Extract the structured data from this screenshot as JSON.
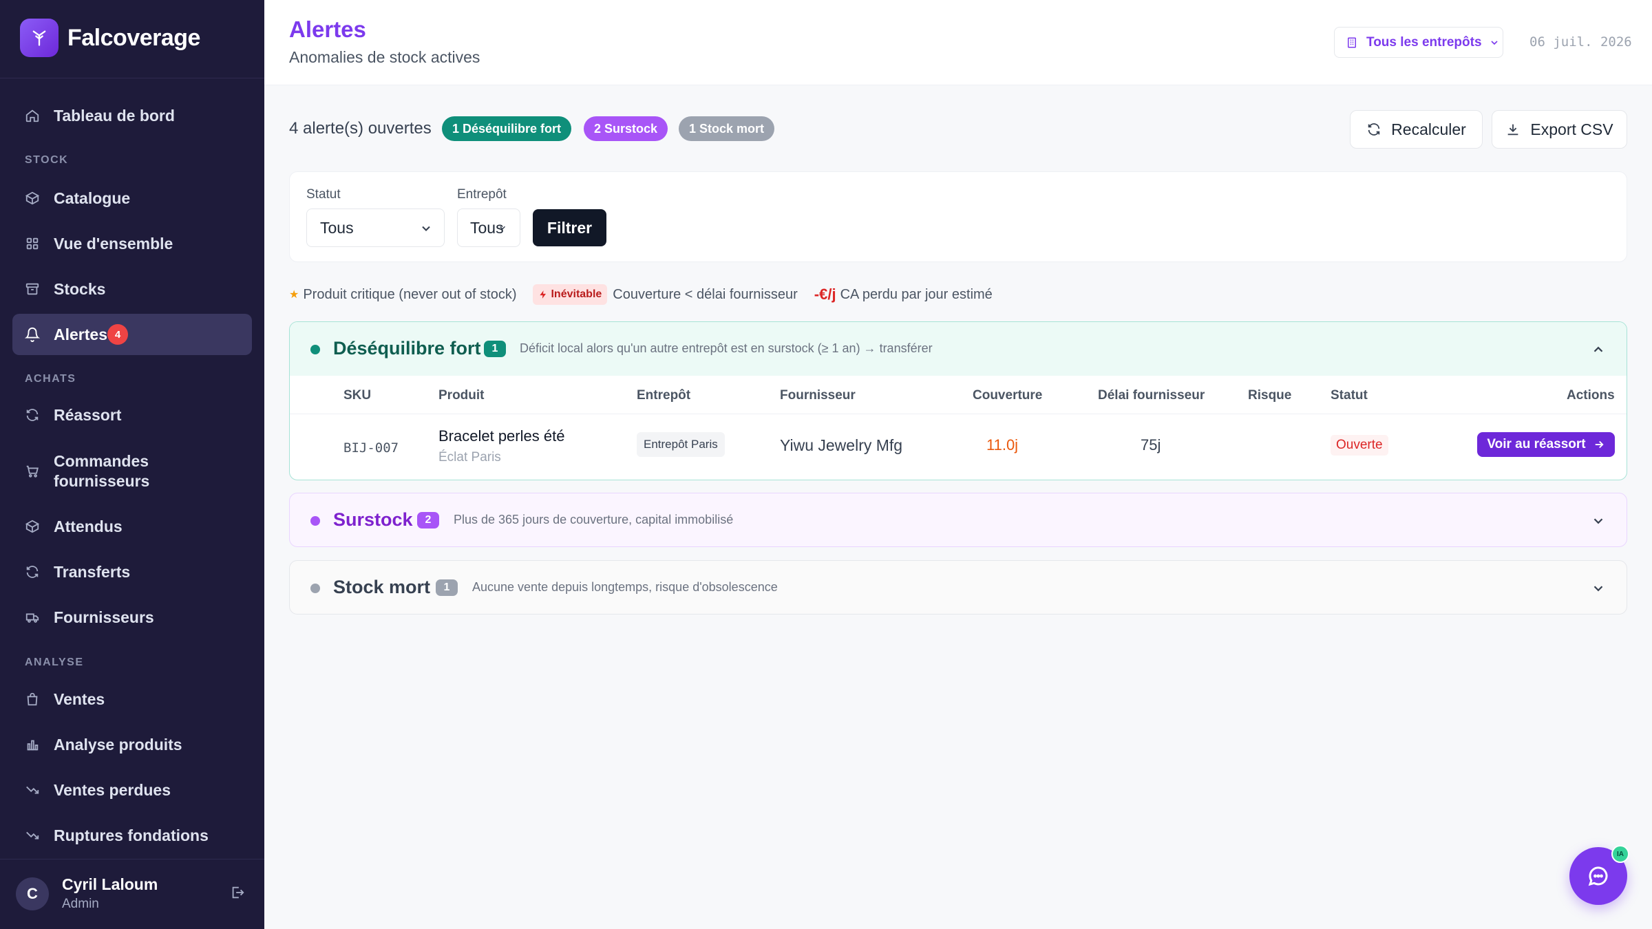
{
  "app": {
    "brand_part1": "Falco",
    "brand_part2": "verage"
  },
  "sidebar": {
    "dashboard": "Tableau de bord",
    "section_stock": "STOCK",
    "catalogue": "Catalogue",
    "overview": "Vue d'ensemble",
    "stocks": "Stocks",
    "alerts": "Alertes",
    "alerts_badge": "4",
    "section_achats": "ACHATS",
    "reassort": "Réassort",
    "supplier_orders": "Commandes fournisseurs",
    "expected": "Attendus",
    "transfers": "Transferts",
    "suppliers": "Fournisseurs",
    "section_analyse": "ANALYSE",
    "sales": "Ventes",
    "product_analysis": "Analyse produits",
    "lost_sales": "Ventes perdues",
    "foundation_stockouts": "Ruptures fondations"
  },
  "user": {
    "initial": "C",
    "name": "Cyril Laloum",
    "role": "Admin"
  },
  "header": {
    "title": "Alertes",
    "subtitle": "Anomalies de stock actives",
    "warehouse_selector": "Tous les entrepôts",
    "date": "06 juil. 2026"
  },
  "summary": {
    "count_text": "4 alerte(s) ouvertes",
    "pill_imbalance": "1 Déséquilibre fort",
    "pill_overstock": "2 Surstock",
    "pill_dead": "1 Stock mort"
  },
  "actions": {
    "recalculate": "Recalculer",
    "export": "Export CSV"
  },
  "filters": {
    "status_label": "Statut",
    "status_value": "Tous",
    "warehouse_label": "Entrepôt",
    "warehouse_value": "Tous",
    "submit": "Filtrer"
  },
  "legend": {
    "star": "★",
    "critical": "Produit critique (never out of stock)",
    "inevitable_badge": "Inévitable",
    "inevitable_text": "Couverture < délai fournisseur",
    "loss_badge": "-€/j",
    "loss_text": "CA perdu par jour estimé"
  },
  "groups": [
    {
      "title": "Déséquilibre fort",
      "count": "1",
      "description": "Déficit local alors qu'un autre entrepôt est en surstock (≥ 1 an) → transférer",
      "expanded": true,
      "columns": [
        "SKU",
        "Produit",
        "Entrepôt",
        "Fournisseur",
        "Couverture",
        "Délai fournisseur",
        "Risque",
        "Statut",
        "Actions"
      ],
      "rows": [
        {
          "sku": "BIJ-007",
          "product": "Bracelet perles été",
          "brand": "Éclat Paris",
          "warehouse": "Entrepôt Paris",
          "supplier": "Yiwu Jewelry Mfg",
          "coverage": "11.0j",
          "lead_time": "75j",
          "risk": "",
          "status": "Ouverte",
          "action": "Voir au réassort"
        }
      ]
    },
    {
      "title": "Surstock",
      "count": "2",
      "description": "Plus de 365 jours de couverture, capital immobilisé",
      "expanded": false
    },
    {
      "title": "Stock mort",
      "count": "1",
      "description": "Aucune vente depuis longtemps, risque d'obsolescence",
      "expanded": false
    }
  ],
  "chat": {
    "badge": "IA"
  },
  "colors": {
    "sidebar_bg": "#1e1b3a",
    "accent": "#7c3aed",
    "imbalance": "#0f8f7a",
    "overstock": "#a855f7",
    "dead_stock": "#9ca3af",
    "alert_red": "#ef4444"
  }
}
